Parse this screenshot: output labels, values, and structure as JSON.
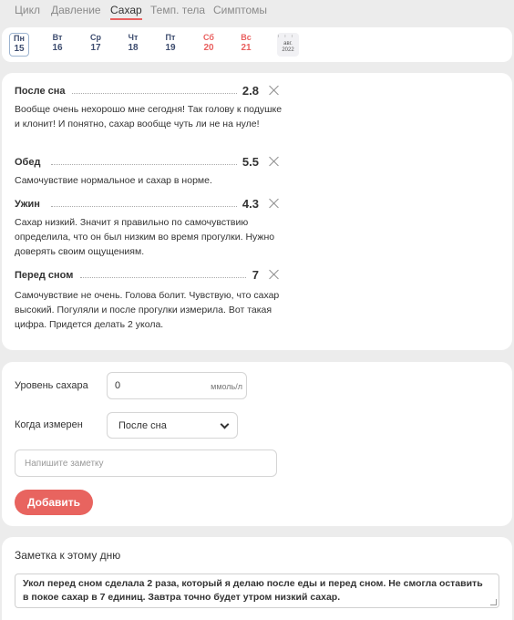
{
  "tabs": [
    {
      "label": "Цикл",
      "active": false
    },
    {
      "label": "Давление",
      "active": false
    },
    {
      "label": "Сахар",
      "active": true
    },
    {
      "label": "Темп. тела",
      "active": false
    },
    {
      "label": "Симптомы",
      "active": false
    }
  ],
  "week": {
    "days": [
      {
        "name": "Пн",
        "date": "15",
        "selected": true,
        "weekend": false
      },
      {
        "name": "Вт",
        "date": "16",
        "selected": false,
        "weekend": false
      },
      {
        "name": "Ср",
        "date": "17",
        "selected": false,
        "weekend": false
      },
      {
        "name": "Чт",
        "date": "18",
        "selected": false,
        "weekend": false
      },
      {
        "name": "Пт",
        "date": "19",
        "selected": false,
        "weekend": false
      },
      {
        "name": "Сб",
        "date": "20",
        "selected": false,
        "weekend": true
      },
      {
        "name": "Вс",
        "date": "21",
        "selected": false,
        "weekend": true
      }
    ],
    "calendar": {
      "month": "авг.",
      "year": "2022",
      "icon": "calendar-icon"
    }
  },
  "entries": [
    {
      "name": "После сна",
      "value": "2.8",
      "text": "Вообще очень нехорошо мне сегодня! Так голову к подушке и клонит! И понятно, сахар вообще чуть ли не на нуле!"
    },
    {
      "name": "Обед",
      "value": "5.5",
      "text": "Самочувствие нормальное и сахар в норме."
    },
    {
      "name": "Ужин",
      "value": "4.3",
      "text": "Сахар низкий. Значит я правильно по самочувствию определила, что он был низким во время прогулки. Нужно доверять своим ощущениям."
    },
    {
      "name": "Перед сном",
      "value": "7",
      "text": "Самочувствие не очень. Голова болит. Чувствую, что сахар высокий. Погуляли и после прогулки измерила. Вот такая цифра. Придется делать 2 укола."
    }
  ],
  "form": {
    "level_label": "Уровень сахара",
    "level_value": "0",
    "level_unit": "ммоль/л",
    "when_label": "Когда измерен",
    "when_value": "После сна",
    "note_placeholder": "Напишите заметку",
    "add_button": "Добавить"
  },
  "day_note": {
    "title": "Заметка к этому дню",
    "text": "Укол перед сном сделала 2 раза, который я делаю после еды и перед сном. Не смогла оставить в покое сахар в 7 единиц. Завтра точно будет утром низкий сахар."
  },
  "colors": {
    "accent": "#e9605f",
    "weekday": "#3d4c6f",
    "background": "#ececec"
  }
}
